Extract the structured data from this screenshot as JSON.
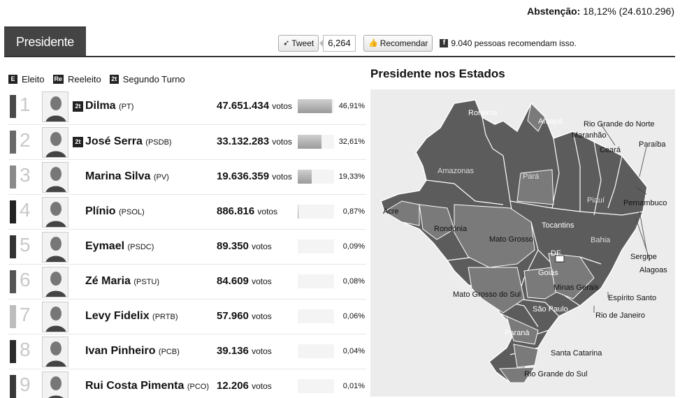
{
  "header": {
    "abstencao_label": "Abstenção:",
    "abstencao_value": "18,12% (24.610.296)"
  },
  "tab": {
    "label": "Presidente"
  },
  "social": {
    "tweet_label": "Tweet",
    "tweet_count": "6,264",
    "recommend_label": "Recomendar",
    "facebook_text": "9.040 pessoas recomendam isso."
  },
  "legend": [
    {
      "badge": "E",
      "label": "Eleito"
    },
    {
      "badge": "Re",
      "label": "Reeleito"
    },
    {
      "badge": "2t",
      "label": "Segundo Turno"
    }
  ],
  "candidates": [
    {
      "rank": "1",
      "name": "Dilma",
      "party": "(PT)",
      "votes": "47.651.434",
      "votes_unit": "votos",
      "pct": "46,91%",
      "share": 46.91,
      "second_round": true,
      "color": "#4a4a4a"
    },
    {
      "rank": "2",
      "name": "José Serra",
      "party": "(PSDB)",
      "votes": "33.132.283",
      "votes_unit": "votos",
      "pct": "32,61%",
      "share": 32.61,
      "second_round": true,
      "color": "#6a6a6a"
    },
    {
      "rank": "3",
      "name": "Marina Silva",
      "party": "(PV)",
      "votes": "19.636.359",
      "votes_unit": "votos",
      "pct": "19,33%",
      "share": 19.33,
      "second_round": false,
      "color": "#8a8a8a"
    },
    {
      "rank": "4",
      "name": "Plínio",
      "party": "(PSOL)",
      "votes": "886.816",
      "votes_unit": "votos",
      "pct": "0,87%",
      "share": 0.87,
      "second_round": false,
      "color": "#222222"
    },
    {
      "rank": "5",
      "name": "Eymael",
      "party": "(PSDC)",
      "votes": "89.350",
      "votes_unit": "votos",
      "pct": "0,09%",
      "share": 0.09,
      "second_round": false,
      "color": "#333333"
    },
    {
      "rank": "6",
      "name": "Zé Maria",
      "party": "(PSTU)",
      "votes": "84.609",
      "votes_unit": "votos",
      "pct": "0,08%",
      "share": 0.08,
      "second_round": false,
      "color": "#555555"
    },
    {
      "rank": "7",
      "name": "Levy Fidelix",
      "party": "(PRTB)",
      "votes": "57.960",
      "votes_unit": "votos",
      "pct": "0,06%",
      "share": 0.06,
      "second_round": false,
      "color": "#bdbdbd"
    },
    {
      "rank": "8",
      "name": "Ivan Pinheiro",
      "party": "(PCB)",
      "votes": "39.136",
      "votes_unit": "votos",
      "pct": "0,04%",
      "share": 0.04,
      "second_round": false,
      "color": "#2b2b2b"
    },
    {
      "rank": "9",
      "name": "Rui Costa Pimenta",
      "party": "(PCO)",
      "votes": "12.206",
      "votes_unit": "votos",
      "pct": "0,01%",
      "share": 0.01,
      "second_round": false,
      "color": "#3a3a3a"
    }
  ],
  "map": {
    "title": "Presidente nos Estados",
    "states": [
      "Roraima",
      "Amapá",
      "Amazonas",
      "Pará",
      "Maranhão",
      "Ceará",
      "Rio Grande do Norte",
      "Paraíba",
      "Pernambuco",
      "Alagoas",
      "Sergipe",
      "Bahia",
      "Piauí",
      "Tocantins",
      "Acre",
      "Rondônia",
      "Mato Grosso",
      "DF",
      "Goiás",
      "Minas Gerais",
      "Espírito Santo",
      "Rio de Janeiro",
      "São Paulo",
      "Mato Grosso do Sul",
      "Paraná",
      "Santa Catarina",
      "Rio Grande do Sul"
    ]
  }
}
